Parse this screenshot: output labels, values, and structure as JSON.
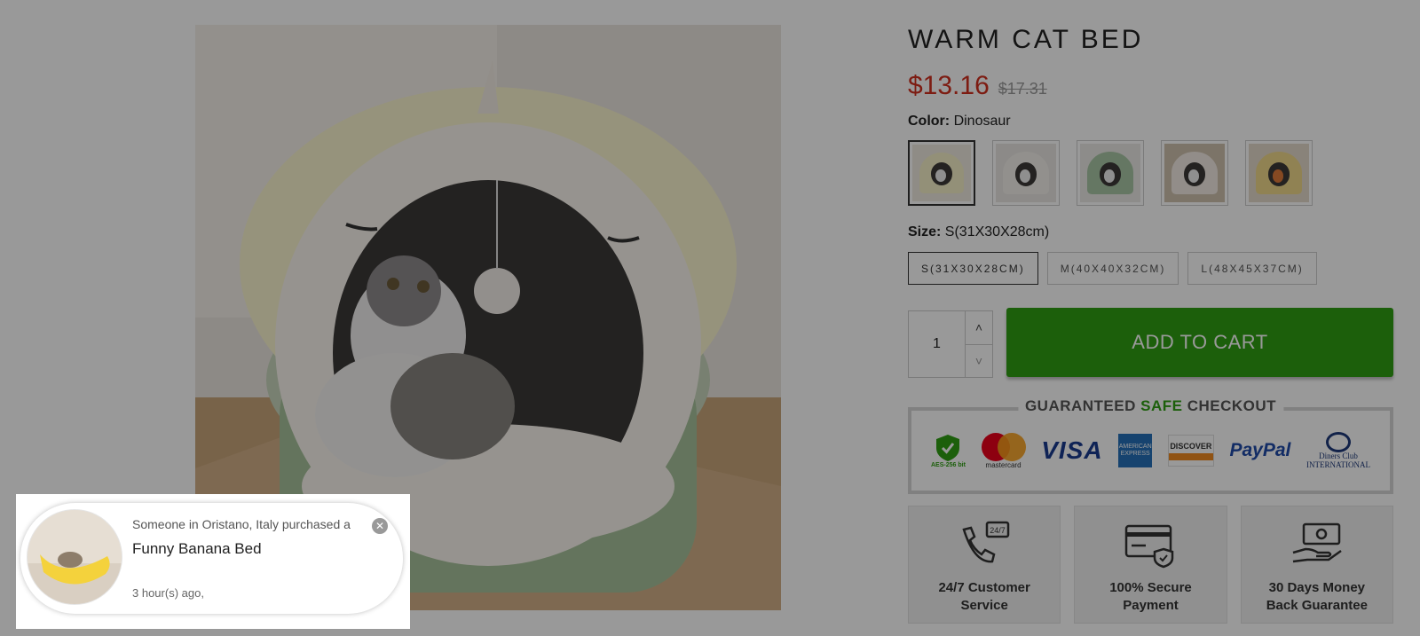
{
  "product": {
    "title": "WARM CAT BED",
    "price": "$13.16",
    "compare_price": "$17.31",
    "color_label": "Color:",
    "color_value": "Dinosaur",
    "size_label": "Size:",
    "size_value": "S(31X30X28cm)",
    "sizes": [
      "S(31X30X28CM)",
      "M(40X40X32CM)",
      "L(48X45X37CM)"
    ],
    "quantity": "1",
    "add_to_cart": "ADD TO CART",
    "accent_price_color": "#d1301f",
    "cart_button_color": "#2f9e13"
  },
  "guarantee": {
    "title_part1": "GUARANTEED",
    "title_safe": "SAFE",
    "title_part2": "CHECKOUT",
    "payments": {
      "aes": "AES-256 bit",
      "mastercard": "mastercard",
      "visa": "VISA",
      "amex": "AMERICAN EXPRESS",
      "discover": "DISCOVER",
      "paypal": "PayPal",
      "diners1": "Diners Club",
      "diners2": "INTERNATIONAL"
    }
  },
  "features": [
    {
      "line1": "24/7 Customer",
      "line2": "Service",
      "icon": "phone-24-7-icon"
    },
    {
      "line1": "100% Secure",
      "line2": "Payment",
      "icon": "secure-card-icon"
    },
    {
      "line1": "30 Days Money",
      "line2": "Back Guarantee",
      "icon": "money-back-icon"
    }
  ],
  "popup": {
    "line1": "Someone in Oristano, Italy purchased a",
    "product": "Funny Banana Bed",
    "time": "3 hour(s) ago,"
  }
}
